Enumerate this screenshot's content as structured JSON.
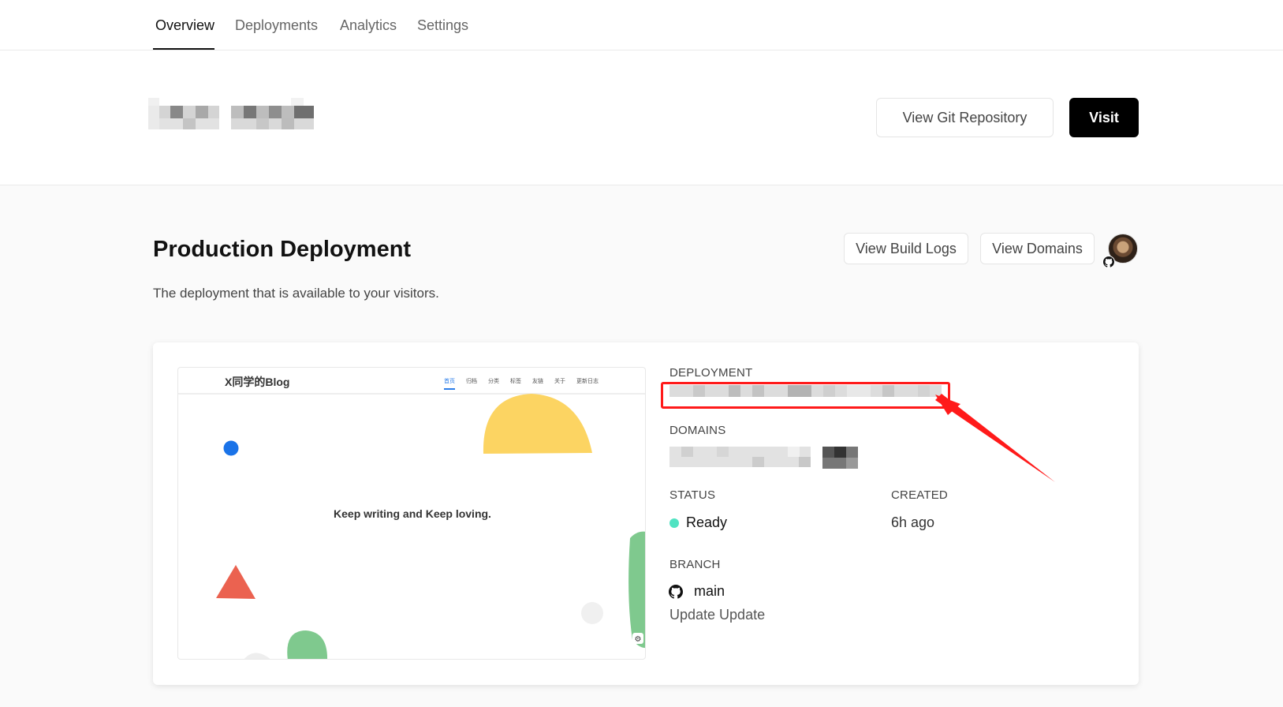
{
  "nav": {
    "tabs": [
      {
        "label": "Overview",
        "active": true
      },
      {
        "label": "Deployments",
        "active": false
      },
      {
        "label": "Analytics",
        "active": false
      },
      {
        "label": "Settings",
        "active": false
      }
    ]
  },
  "project": {
    "view_git_label": "View Git Repository",
    "visit_label": "Visit"
  },
  "production": {
    "title": "Production Deployment",
    "description": "The deployment that is available to your visitors.",
    "view_build_logs_label": "View Build Logs",
    "view_domains_label": "View Domains"
  },
  "preview": {
    "blog_title": "X同学的Blog",
    "nav_items": [
      "首页",
      "归档",
      "分类",
      "标签",
      "友链",
      "关于",
      "更新日志"
    ],
    "tagline": "Keep writing and Keep loving."
  },
  "deployment": {
    "deployment_label": "DEPLOYMENT",
    "domains_label": "DOMAINS",
    "status_label": "STATUS",
    "status_value": "Ready",
    "created_label": "CREATED",
    "created_value": "6h ago",
    "branch_label": "BRANCH",
    "branch_value": "main",
    "commit_message": "Update Update"
  },
  "colors": {
    "status_ready": "#50e3c2",
    "accent": "#000000",
    "annotation": "#ff1a1a"
  },
  "icons": {
    "github": "github-icon",
    "settings": "gear-icon"
  }
}
